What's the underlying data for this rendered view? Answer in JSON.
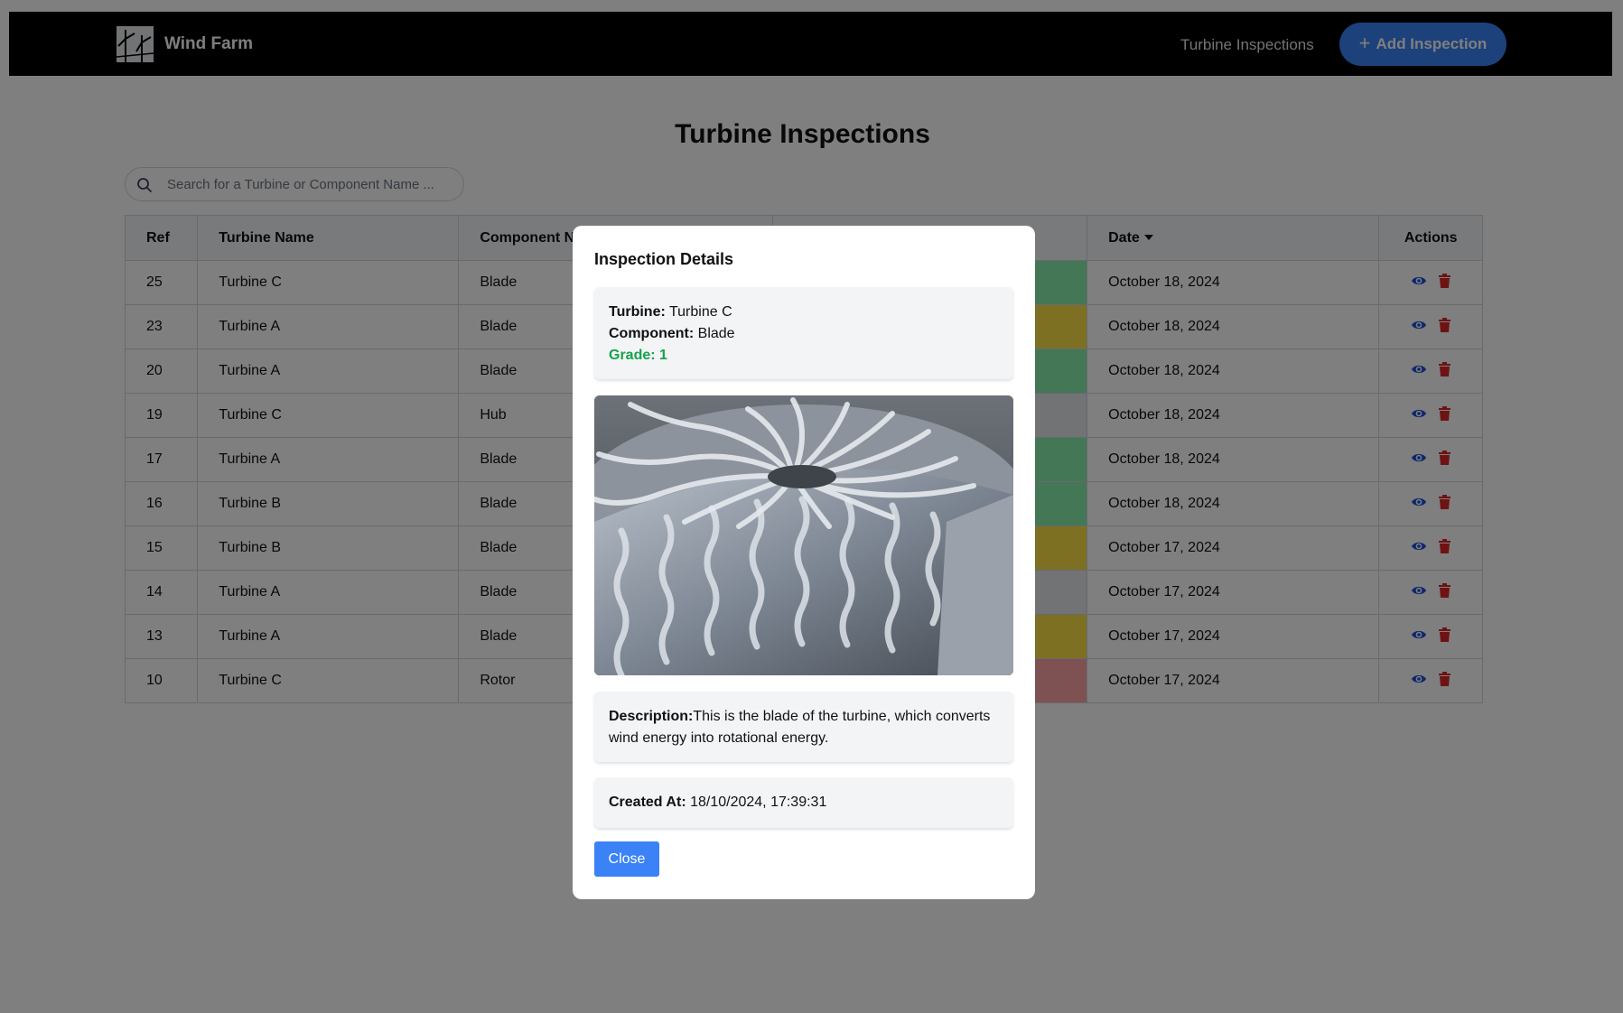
{
  "navbar": {
    "brand": "Wind Farm",
    "link": "Turbine Inspections",
    "add_button": "Add Inspection"
  },
  "page": {
    "title": "Turbine Inspections"
  },
  "search": {
    "placeholder": "Search for a Turbine or Component Name ..."
  },
  "table": {
    "columns": {
      "ref": "Ref",
      "turbine": "Turbine Name",
      "component": "Component Name",
      "date": "Date",
      "actions": "Actions"
    },
    "rows": [
      {
        "ref": "25",
        "turbine": "Turbine C",
        "component": "Blade",
        "grade_color": "#86efac",
        "date": "October 18, 2024"
      },
      {
        "ref": "23",
        "turbine": "Turbine A",
        "component": "Blade",
        "grade_color": "#fde047",
        "date": "October 18, 2024"
      },
      {
        "ref": "20",
        "turbine": "Turbine A",
        "component": "Blade",
        "grade_color": "#86efac",
        "date": "October 18, 2024"
      },
      {
        "ref": "19",
        "turbine": "Turbine C",
        "component": "Hub",
        "grade_color": "#e5e7eb",
        "date": "October 18, 2024"
      },
      {
        "ref": "17",
        "turbine": "Turbine A",
        "component": "Blade",
        "grade_color": "#86efac",
        "date": "October 18, 2024"
      },
      {
        "ref": "16",
        "turbine": "Turbine B",
        "component": "Blade",
        "grade_color": "#86efac",
        "date": "October 18, 2024"
      },
      {
        "ref": "15",
        "turbine": "Turbine B",
        "component": "Blade",
        "grade_color": "#fde047",
        "date": "October 17, 2024"
      },
      {
        "ref": "14",
        "turbine": "Turbine A",
        "component": "Blade",
        "grade_color": "#e5e7eb",
        "date": "October 17, 2024"
      },
      {
        "ref": "13",
        "turbine": "Turbine A",
        "component": "Blade",
        "grade_color": "#fde047",
        "date": "October 17, 2024"
      },
      {
        "ref": "10",
        "turbine": "Turbine C",
        "component": "Rotor",
        "grade_color": "#fca5a5",
        "date": "October 17, 2024"
      }
    ]
  },
  "modal": {
    "title": "Inspection Details",
    "turbine_label": "Turbine:",
    "turbine_value": "Turbine C",
    "component_label": "Component:",
    "component_value": "Blade",
    "grade_label": "Grade:",
    "grade_value": "1",
    "description_label": "Description:",
    "description_value": "This is the blade of the turbine, which converts wind energy into rotational energy.",
    "created_label": "Created At:",
    "created_value": "18/10/2024, 17:39:31",
    "close_button": "Close"
  },
  "colors": {
    "navbar": "#000000",
    "primary": "#3b82f6",
    "grade_good": "#16a34a",
    "view_icon": "#1d4ed8",
    "delete_icon": "#dc2626"
  },
  "icons": [
    "wind-farm-logo-icon",
    "plus-icon",
    "search-icon",
    "sort-caret-icon",
    "eye-icon",
    "trash-icon"
  ]
}
